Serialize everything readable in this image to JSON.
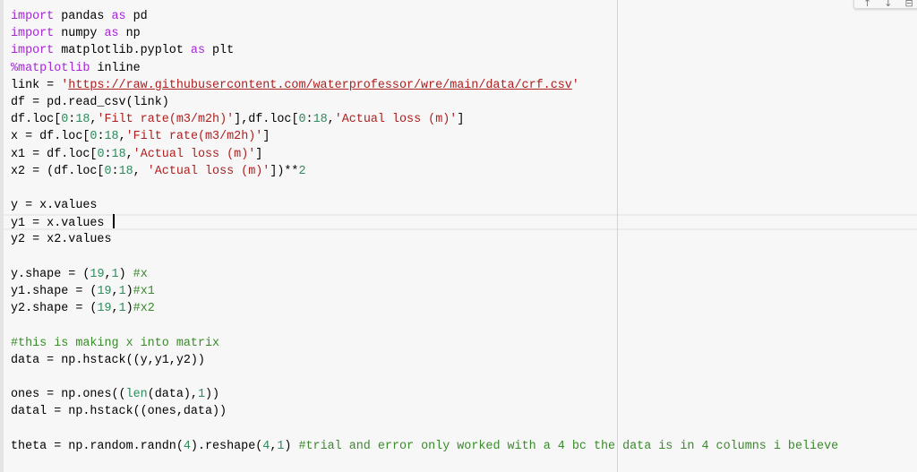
{
  "toolbar": {
    "icons": [
      {
        "name": "move-up-icon",
        "glyph": "↑"
      },
      {
        "name": "move-down-icon",
        "glyph": "↓"
      },
      {
        "name": "more-icon",
        "glyph": "⊟"
      }
    ]
  },
  "editor": {
    "cursor_line": 13,
    "lines": [
      [
        [
          "kw",
          "import"
        ],
        [
          "t",
          " pandas "
        ],
        [
          "kw",
          "as"
        ],
        [
          "t",
          " pd"
        ]
      ],
      [
        [
          "kw",
          "import"
        ],
        [
          "t",
          " numpy "
        ],
        [
          "kw",
          "as"
        ],
        [
          "t",
          " np"
        ]
      ],
      [
        [
          "kw",
          "import"
        ],
        [
          "t",
          " matplotlib.pyplot "
        ],
        [
          "kw",
          "as"
        ],
        [
          "t",
          " plt"
        ]
      ],
      [
        [
          "magic",
          "%matplotlib"
        ],
        [
          "t",
          " inline"
        ]
      ],
      [
        [
          "t",
          "link = "
        ],
        [
          "str",
          "'"
        ],
        [
          "link",
          "https://raw.githubusercontent.com/waterprofessor/wre/main/data/crf.csv"
        ],
        [
          "str",
          "'"
        ]
      ],
      [
        [
          "t",
          "df = pd.read_csv(link)"
        ]
      ],
      [
        [
          "t",
          "df.loc["
        ],
        [
          "num",
          "0"
        ],
        [
          "t",
          ":"
        ],
        [
          "num",
          "18"
        ],
        [
          "t",
          ","
        ],
        [
          "str",
          "'Filt rate(m3/m2h)'"
        ],
        [
          "t",
          "],df.loc["
        ],
        [
          "num",
          "0"
        ],
        [
          "t",
          ":"
        ],
        [
          "num",
          "18"
        ],
        [
          "t",
          ","
        ],
        [
          "str",
          "'Actual loss (m)'"
        ],
        [
          "t",
          "]"
        ]
      ],
      [
        [
          "t",
          "x = df.loc["
        ],
        [
          "num",
          "0"
        ],
        [
          "t",
          ":"
        ],
        [
          "num",
          "18"
        ],
        [
          "t",
          ","
        ],
        [
          "str",
          "'Filt rate(m3/m2h)'"
        ],
        [
          "t",
          "]"
        ]
      ],
      [
        [
          "t",
          "x1 = df.loc["
        ],
        [
          "num",
          "0"
        ],
        [
          "t",
          ":"
        ],
        [
          "num",
          "18"
        ],
        [
          "t",
          ","
        ],
        [
          "str",
          "'Actual loss (m)'"
        ],
        [
          "t",
          "]"
        ]
      ],
      [
        [
          "t",
          "x2 = (df.loc["
        ],
        [
          "num",
          "0"
        ],
        [
          "t",
          ":"
        ],
        [
          "num",
          "18"
        ],
        [
          "t",
          ", "
        ],
        [
          "str",
          "'Actual loss (m)'"
        ],
        [
          "t",
          "])**"
        ],
        [
          "num",
          "2"
        ]
      ],
      [],
      [
        [
          "t",
          "y = x.values"
        ]
      ],
      [
        [
          "t",
          "y1 = x.values "
        ]
      ],
      [
        [
          "t",
          "y2 = x2.values"
        ]
      ],
      [],
      [
        [
          "t",
          "y.shape = ("
        ],
        [
          "num",
          "19"
        ],
        [
          "t",
          ","
        ],
        [
          "num",
          "1"
        ],
        [
          "t",
          ") "
        ],
        [
          "cmt",
          "#x"
        ]
      ],
      [
        [
          "t",
          "y1.shape = ("
        ],
        [
          "num",
          "19"
        ],
        [
          "t",
          ","
        ],
        [
          "num",
          "1"
        ],
        [
          "t",
          ")"
        ],
        [
          "cmt",
          "#x1"
        ]
      ],
      [
        [
          "t",
          "y2.shape = ("
        ],
        [
          "num",
          "19"
        ],
        [
          "t",
          ","
        ],
        [
          "num",
          "1"
        ],
        [
          "t",
          ")"
        ],
        [
          "cmt",
          "#x2"
        ]
      ],
      [],
      [
        [
          "cmt",
          "#this is making x into matrix"
        ]
      ],
      [
        [
          "t",
          "data = np.hstack((y,y1,y2))"
        ]
      ],
      [],
      [
        [
          "t",
          "ones = np.ones(("
        ],
        [
          "bi",
          "len"
        ],
        [
          "t",
          "(data),"
        ],
        [
          "num",
          "1"
        ],
        [
          "t",
          "))"
        ]
      ],
      [
        [
          "t",
          "datal = np.hstack((ones,data))"
        ]
      ],
      [],
      [
        [
          "t",
          "theta = np.random.randn("
        ],
        [
          "num",
          "4"
        ],
        [
          "t",
          ").reshape("
        ],
        [
          "num",
          "4"
        ],
        [
          "t",
          ","
        ],
        [
          "num",
          "1"
        ],
        [
          "t",
          ") "
        ],
        [
          "cmt",
          "#trial and error only worked with a 4 bc the data is in 4 columns i believe"
        ]
      ]
    ]
  }
}
